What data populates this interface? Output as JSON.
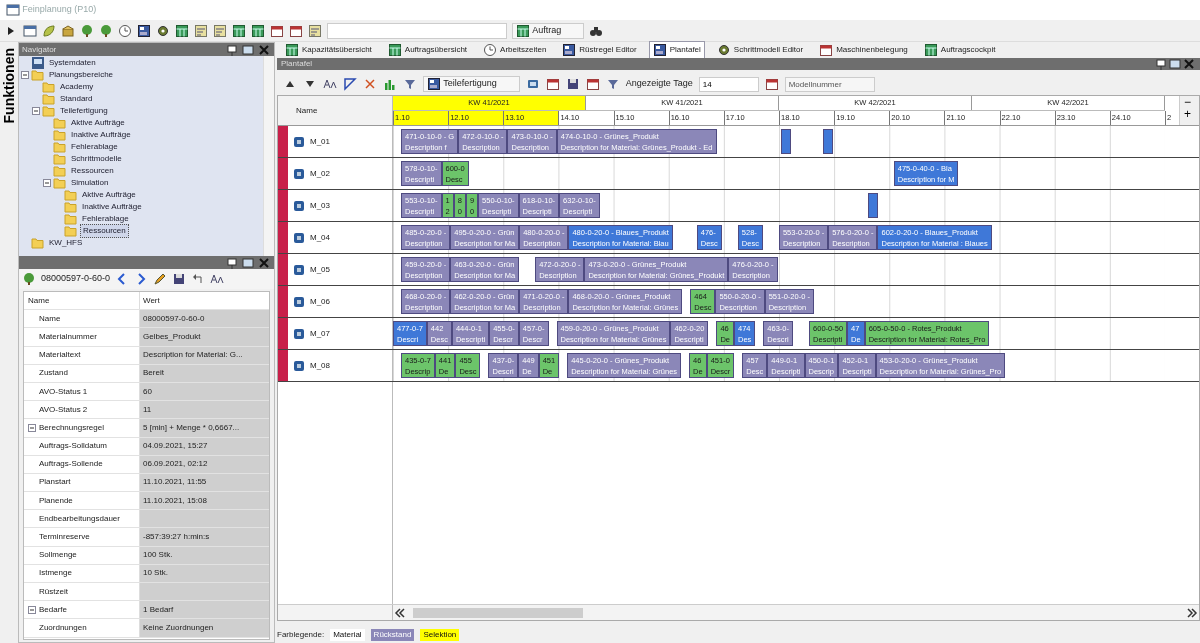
{
  "window": {
    "title": "Feinplanung (P10)"
  },
  "side_label": "Funktionen",
  "main_toolbar": {
    "dropdown": "Auftrag"
  },
  "navigator": {
    "title": "Navigator",
    "tree": [
      {
        "label": "Systemdaten",
        "kind": "system",
        "selected": false
      },
      {
        "label": "Planungsbereiche",
        "kind": "folder",
        "selected": false,
        "children": [
          {
            "label": "Academy",
            "kind": "folder",
            "selected": false
          },
          {
            "label": "Standard",
            "kind": "folder",
            "selected": false
          },
          {
            "label": "Teilefertigung",
            "kind": "folder",
            "selected": false,
            "children": [
              {
                "label": "Aktive Aufträge",
                "kind": "folder",
                "selected": false
              },
              {
                "label": "Inaktive Aufträge",
                "kind": "folder",
                "selected": false
              },
              {
                "label": "Fehlerablage",
                "kind": "folder",
                "selected": false
              },
              {
                "label": "Schrittmodelle",
                "kind": "folder",
                "selected": false
              },
              {
                "label": "Ressourcen",
                "kind": "folder",
                "selected": false
              },
              {
                "label": "Simulation",
                "kind": "folder",
                "selected": false,
                "children": [
                  {
                    "label": "Aktive Aufträge",
                    "kind": "folder",
                    "selected": false
                  },
                  {
                    "label": "Inaktive Aufträge",
                    "kind": "folder",
                    "selected": false
                  },
                  {
                    "label": "Fehlerablage",
                    "kind": "folder",
                    "selected": false
                  },
                  {
                    "label": "Ressourcen",
                    "kind": "folder",
                    "selected": true
                  }
                ]
              }
            ]
          }
        ]
      },
      {
        "label": "KW_HFS",
        "kind": "folder",
        "selected": false
      }
    ]
  },
  "details": {
    "object_id": "08000597-0-60-0",
    "columns": [
      "Name",
      "Wert"
    ],
    "rows": [
      {
        "name": "Name",
        "value": "08000597-0-60-0",
        "expandable": false
      },
      {
        "name": "Materialnummer",
        "value": "Gelbes_Produkt",
        "expandable": false
      },
      {
        "name": "Materialtext",
        "value": "Description for Material: G...",
        "expandable": false
      },
      {
        "name": "Zustand",
        "value": "Bereit",
        "expandable": false
      },
      {
        "name": "AVO-Status 1",
        "value": "60",
        "expandable": false
      },
      {
        "name": "AVO-Status 2",
        "value": "11",
        "expandable": false
      },
      {
        "name": "Berechnungsregel",
        "value": "5 [min] + Menge * 0,6667...",
        "expandable": true
      },
      {
        "name": "Auftrags-Solldatum",
        "value": "04.09.2021, 15:27",
        "expandable": false
      },
      {
        "name": "Auftrags-Sollende",
        "value": "06.09.2021, 02:12",
        "expandable": false
      },
      {
        "name": "Planstart",
        "value": "11.10.2021, 11:55",
        "expandable": false
      },
      {
        "name": "Planende",
        "value": "11.10.2021, 15:08",
        "expandable": false
      },
      {
        "name": "Endbearbeitungsdauer",
        "expandable": false
      },
      {
        "name": "Terminreserve",
        "value": "-857:39:27 h:min:s",
        "expandable": false
      },
      {
        "name": "Sollmenge",
        "value": "100 Stk.",
        "expandable": false
      },
      {
        "name": "Istmenge",
        "value": "10 Stk.",
        "expandable": false
      },
      {
        "name": "Rüstzeit",
        "expandable": false
      },
      {
        "name": "Bedarfe",
        "value": "1 Bedarf",
        "expandable": true
      },
      {
        "name": "Zuordnungen",
        "value": "Keine Zuordnungen",
        "expandable": false
      }
    ]
  },
  "tabs": [
    {
      "label": "Kapazitätsübersicht",
      "selected": false
    },
    {
      "label": "Auftragsübersicht",
      "selected": false
    },
    {
      "label": "Arbeitszeiten",
      "selected": false
    },
    {
      "label": "Rüstregel Editor",
      "selected": false
    },
    {
      "label": "Plantafel",
      "selected": true
    },
    {
      "label": "Schrittmodell Editor",
      "selected": false
    },
    {
      "label": "Maschinenbelegung",
      "selected": false
    },
    {
      "label": "Auftragscockpit",
      "selected": false
    }
  ],
  "plantafel": {
    "title": "Plantafel",
    "area": "Teilefertigung",
    "days_label": "Angezeigte Tage",
    "days_value": "14",
    "model_placeholder": "Modellnummer",
    "name_header": "Name",
    "weeks": [
      {
        "label": "KW 41/2021",
        "selected": true
      },
      {
        "label": "KW 41/2021",
        "selected": false
      },
      {
        "label": "KW 42/2021",
        "selected": false
      },
      {
        "label": "KW 42/2021",
        "selected": false
      }
    ],
    "days": [
      {
        "label": "1.10",
        "selected": true
      },
      {
        "label": "12.10",
        "selected": true
      },
      {
        "label": "13.10",
        "selected": true
      },
      {
        "label": "14.10",
        "selected": false
      },
      {
        "label": "15.10",
        "selected": false
      },
      {
        "label": "16.10",
        "selected": false
      },
      {
        "label": "17.10",
        "selected": false
      },
      {
        "label": "18.10",
        "selected": false
      },
      {
        "label": "19.10",
        "selected": false
      },
      {
        "label": "20.10",
        "selected": false
      },
      {
        "label": "21.10",
        "selected": false
      },
      {
        "label": "22.10",
        "selected": false
      },
      {
        "label": "23.10",
        "selected": false
      },
      {
        "label": "24.10",
        "selected": false
      }
    ],
    "days_tail": "2",
    "zoom_buttons": [
      "−",
      "+"
    ],
    "rows": [
      {
        "name": "M_01",
        "bars": [
          {
            "kind": "gap"
          },
          {
            "kind": "task",
            "color": "#8b87b8",
            "label": "471-0-10-0 - G",
            "description": "Description f"
          },
          {
            "kind": "task",
            "color": "#8b87b8",
            "label": "472-0-10-0 -",
            "description": "Description"
          },
          {
            "kind": "task",
            "color": "#8b87b8",
            "label": "473-0-10-0 -",
            "description": "Description"
          },
          {
            "kind": "task",
            "color": "#8b87b8",
            "label": "474-0-10-0 - Grünes_Produkt",
            "description": "Description for Material: Grünes_Produkt - Ed"
          },
          {
            "kind": "gap"
          },
          {
            "kind": "gap"
          },
          {
            "kind": "gap"
          },
          {
            "kind": "gap"
          },
          {
            "kind": "gap"
          },
          {
            "kind": "gap"
          },
          {
            "kind": "gap"
          },
          {
            "kind": "gap"
          },
          {
            "kind": "block",
            "color": "#3f78d8"
          },
          {
            "kind": "gap"
          },
          {
            "kind": "gap"
          },
          {
            "kind": "gap"
          },
          {
            "kind": "gap"
          },
          {
            "kind": "block",
            "color": "#3f78d8"
          }
        ]
      },
      {
        "name": "M_02",
        "bars": [
          {
            "kind": "gap"
          },
          {
            "kind": "task",
            "color": "#8b87b8",
            "label": "578-0-10-",
            "description": "Descripti"
          },
          {
            "kind": "task",
            "color": "#6cc46a",
            "label": "600-0",
            "description": "Desc"
          },
          {
            "kind": "day-gap"
          },
          {
            "kind": "day-gap"
          },
          {
            "kind": "day-gap"
          },
          {
            "kind": "day-gap"
          },
          {
            "kind": "day-gap"
          },
          {
            "kind": "day-gap"
          },
          {
            "kind": "day-gap"
          },
          {
            "kind": "gap"
          },
          {
            "kind": "gap"
          },
          {
            "kind": "gap"
          },
          {
            "kind": "gap"
          },
          {
            "kind": "gap"
          },
          {
            "kind": "task",
            "color": "#3f78d8",
            "label": "475-0-40-0 - Bla",
            "description": "Description for M"
          }
        ]
      },
      {
        "name": "M_03",
        "bars": [
          {
            "kind": "gap"
          },
          {
            "kind": "task",
            "color": "#8b87b8",
            "label": "553-0-10-",
            "description": "Descripti"
          },
          {
            "kind": "task",
            "color": "#6cc46a",
            "label": "1",
            "description": "2"
          },
          {
            "kind": "task",
            "color": "#6cc46a",
            "label": "8",
            "description": "0"
          },
          {
            "kind": "task",
            "color": "#6cc46a",
            "label": "9",
            "description": "0"
          },
          {
            "kind": "task",
            "color": "#8b87b8",
            "label": "550-0-10-",
            "description": "Descripti"
          },
          {
            "kind": "task",
            "color": "#8b87b8",
            "label": "618-0-10-",
            "description": "Descripti"
          },
          {
            "kind": "task",
            "color": "#8b87b8",
            "label": "632-0-10-",
            "description": "Descripti"
          },
          {
            "kind": "day-gap"
          },
          {
            "kind": "day-gap"
          },
          {
            "kind": "day-gap"
          },
          {
            "kind": "day-gap"
          },
          {
            "kind": "gap"
          },
          {
            "kind": "gap"
          },
          {
            "kind": "gap"
          },
          {
            "kind": "gap"
          },
          {
            "kind": "gap"
          },
          {
            "kind": "gap"
          },
          {
            "kind": "block",
            "color": "#3f78d8"
          }
        ]
      },
      {
        "name": "M_04",
        "bars": [
          {
            "kind": "gap"
          },
          {
            "kind": "task",
            "color": "#8b87b8",
            "label": "485-0-20-0 -",
            "description": "Description"
          },
          {
            "kind": "task",
            "color": "#8b87b8",
            "label": "495-0-20-0 - Grün",
            "description": "Description for Ma"
          },
          {
            "kind": "task",
            "color": "#8b87b8",
            "label": "480-0-20-0 -",
            "description": "Description"
          },
          {
            "kind": "task",
            "color": "#3f78d8",
            "label": "480-0-20-0 - Blaues_Produkt",
            "description": "Description for Material: Blau"
          },
          {
            "kind": "gap"
          },
          {
            "kind": "gap"
          },
          {
            "kind": "gap"
          },
          {
            "kind": "task",
            "color": "#3f78d8",
            "label": "476-",
            "description": "Desc"
          },
          {
            "kind": "gap"
          },
          {
            "kind": "gap"
          },
          {
            "kind": "task",
            "color": "#3f78d8",
            "label": "528-",
            "description": "Desc"
          },
          {
            "kind": "gap"
          },
          {
            "kind": "gap"
          },
          {
            "kind": "task",
            "color": "#8b87b8",
            "label": "553-0-20-0 -",
            "description": "Description"
          },
          {
            "kind": "task",
            "color": "#8b87b8",
            "label": "576-0-20-0 -",
            "description": "Description"
          },
          {
            "kind": "task",
            "color": "#3f78d8",
            "label": "602-0-20-0 - Blaues_Produkt",
            "description": "Description for Material : Blaues"
          }
        ]
      },
      {
        "name": "M_05",
        "bars": [
          {
            "kind": "gap"
          },
          {
            "kind": "task",
            "color": "#8b87b8",
            "label": "459-0-20-0 -",
            "description": "Description"
          },
          {
            "kind": "task",
            "color": "#8b87b8",
            "label": "463-0-20-0 - Grün",
            "description": "Description for Ma"
          },
          {
            "kind": "gap"
          },
          {
            "kind": "gap"
          },
          {
            "kind": "task",
            "color": "#8b87b8",
            "label": "472-0-20-0 -",
            "description": "Description"
          },
          {
            "kind": "task",
            "color": "#8b87b8",
            "label": "473-0-20-0 - Grünes_Produkt",
            "description": "Description for Material: Grünes_Produkt"
          },
          {
            "kind": "task",
            "color": "#8b87b8",
            "label": "476-0-20-0 -",
            "description": "Description"
          }
        ]
      },
      {
        "name": "M_06",
        "bars": [
          {
            "kind": "gap"
          },
          {
            "kind": "task",
            "color": "#8b87b8",
            "label": "468-0-20-0 -",
            "description": "Description"
          },
          {
            "kind": "task",
            "color": "#8b87b8",
            "label": "462-0-20-0 - Grün",
            "description": "Description for Ma"
          },
          {
            "kind": "task",
            "color": "#8b87b8",
            "label": "471-0-20-0 -",
            "description": "Description"
          },
          {
            "kind": "task",
            "color": "#8b87b8",
            "label": "468-0-20-0 - Grünes_Produkt",
            "description": "Description for Material: Grünes"
          },
          {
            "kind": "gap"
          },
          {
            "kind": "task",
            "color": "#6cc46a",
            "label": "464",
            "description": "Desc"
          },
          {
            "kind": "task",
            "color": "#8b87b8",
            "label": "550-0-20-0 -",
            "description": "Description"
          },
          {
            "kind": "task",
            "color": "#8b87b8",
            "label": "551-0-20-0 -",
            "description": "Description"
          }
        ]
      },
      {
        "name": "M_07",
        "bars": [
          {
            "kind": "task",
            "color": "#3f78d8",
            "label": "477-0-7",
            "description": "Descri"
          },
          {
            "kind": "task",
            "color": "#8b87b8",
            "label": "442",
            "description": "Desc"
          },
          {
            "kind": "task",
            "color": "#8b87b8",
            "label": "444-0-1",
            "description": "Descripti"
          },
          {
            "kind": "task",
            "color": "#8b87b8",
            "label": "455-0-",
            "description": "Descr"
          },
          {
            "kind": "task",
            "color": "#8b87b8",
            "label": "457-0-",
            "description": "Descr"
          },
          {
            "kind": "gap"
          },
          {
            "kind": "task",
            "color": "#8b87b8",
            "label": "459-0-20-0 - Grünes_Produkt",
            "description": "Description for Material: Grünes"
          },
          {
            "kind": "task",
            "color": "#8b87b8",
            "label": "462-0-20",
            "description": "Descripti"
          },
          {
            "kind": "gap"
          },
          {
            "kind": "task",
            "color": "#6cc46a",
            "label": "46",
            "description": "De"
          },
          {
            "kind": "task",
            "color": "#3f78d8",
            "label": "474",
            "description": "Des"
          },
          {
            "kind": "gap"
          },
          {
            "kind": "task",
            "color": "#8b87b8",
            "label": "463-0-",
            "description": "Descri"
          },
          {
            "kind": "gap"
          },
          {
            "kind": "gap"
          },
          {
            "kind": "task",
            "color": "#6cc46a",
            "label": "600-0-50",
            "description": "Descripti"
          },
          {
            "kind": "task",
            "color": "#3f78d8",
            "label": "47",
            "description": "De"
          },
          {
            "kind": "task",
            "color": "#6cc46a",
            "label": "605-0-50-0 - Rotes_Produkt",
            "description": "Description for Material: Rotes_Pro"
          }
        ]
      },
      {
        "name": "M_08",
        "bars": [
          {
            "kind": "gap"
          },
          {
            "kind": "task",
            "color": "#6cc46a",
            "label": "435-0-7",
            "description": "Descrip"
          },
          {
            "kind": "task",
            "color": "#6cc46a",
            "label": "441",
            "description": "De"
          },
          {
            "kind": "task",
            "color": "#6cc46a",
            "label": "455",
            "description": "Desc"
          },
          {
            "kind": "gap"
          },
          {
            "kind": "task",
            "color": "#8b87b8",
            "label": "437-0-",
            "description": "Descri"
          },
          {
            "kind": "task",
            "color": "#8b87b8",
            "label": "449",
            "description": "De"
          },
          {
            "kind": "task",
            "color": "#6cc46a",
            "label": "451",
            "description": "De"
          },
          {
            "kind": "gap"
          },
          {
            "kind": "task",
            "color": "#8b87b8",
            "label": "445-0-20-0 - Grünes_Produkt",
            "description": "Description for Material: Grünes"
          },
          {
            "kind": "gap"
          },
          {
            "kind": "task",
            "color": "#6cc46a",
            "label": "46",
            "description": "De"
          },
          {
            "kind": "task",
            "color": "#6cc46a",
            "label": "451-0",
            "description": "Descr"
          },
          {
            "kind": "gap"
          },
          {
            "kind": "task",
            "color": "#8b87b8",
            "label": "457",
            "description": "Desc"
          },
          {
            "kind": "task",
            "color": "#8b87b8",
            "label": "449-0-1",
            "description": "Descripti"
          },
          {
            "kind": "task",
            "color": "#8b87b8",
            "label": "450-0-1",
            "description": "Descrip"
          },
          {
            "kind": "task",
            "color": "#8b87b8",
            "label": "452-0-1",
            "description": "Descripti"
          },
          {
            "kind": "task",
            "color": "#8b87b8",
            "label": "453-0-20-0 - Grünes_Produkt",
            "description": "Description for Material: Grünes_Pro"
          }
        ]
      }
    ]
  },
  "legend": {
    "title": "Farblegende:",
    "items": [
      {
        "label": "Material",
        "color": "#ffffff"
      },
      {
        "label": "Rückstand",
        "color": "#8b87b8"
      },
      {
        "label": "Selektion",
        "color": "#ffff00"
      }
    ]
  }
}
